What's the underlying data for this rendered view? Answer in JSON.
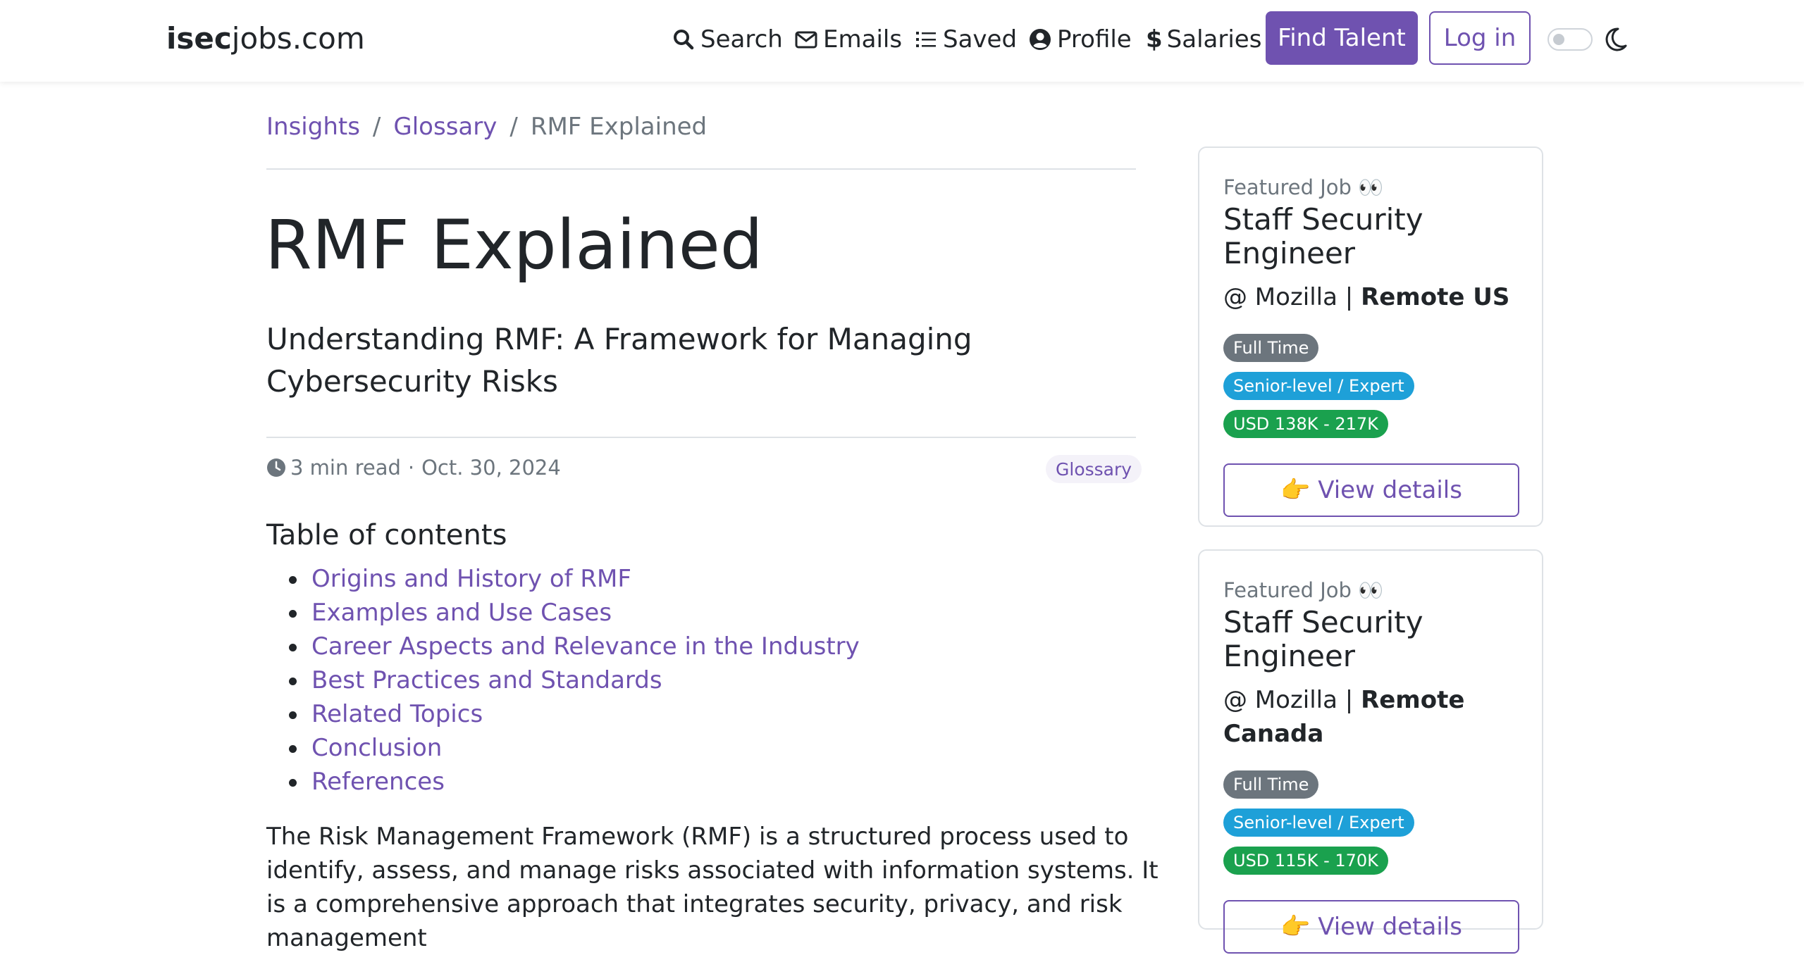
{
  "nav": {
    "brand_bold": "isec",
    "brand_rest": "jobs.com",
    "links": {
      "search": "Search",
      "emails": "Emails",
      "saved": "Saved",
      "profile": "Profile",
      "salaries": "Salaries"
    },
    "find_talent": "Find Talent",
    "login": "Log in",
    "icons": [
      "search-icon",
      "envelope-icon",
      "list-icon",
      "user-circle-icon",
      "dollar-icon",
      "moon-icon"
    ]
  },
  "breadcrumb": {
    "items": [
      "Insights",
      "Glossary"
    ],
    "separator": "/",
    "current": "RMF Explained"
  },
  "article": {
    "title": "RMF Explained",
    "subtitle": "Understanding RMF: A Framework for Managing Cybersecurity Risks",
    "read_time": "3 min read",
    "dot": "·",
    "date": "Oct. 30, 2024",
    "tag": "Glossary",
    "toc_title": "Table of contents",
    "toc": [
      "Origins and History of RMF",
      "Examples and Use Cases",
      "Career Aspects and Relevance in the Industry",
      "Best Practices and Standards",
      "Related Topics",
      "Conclusion",
      "References"
    ],
    "intro": "The Risk Management Framework (RMF) is a structured process used to identify, assess, and manage risks associated with information systems. It is a comprehensive approach that integrates security, privacy, and risk management"
  },
  "sidebar": {
    "cards": [
      {
        "featured": "Featured Job 👀",
        "title": "Staff Security Engineer",
        "company": "@ Mozilla",
        "pipe": "|",
        "location": "Remote US",
        "type": "Full Time",
        "level": "Senior-level / Expert",
        "salary": "USD 138K - 217K",
        "button": "👉 View details"
      },
      {
        "featured": "Featured Job 👀",
        "title": "Staff Security Engineer",
        "company": "@ Mozilla",
        "pipe": "|",
        "location": "Remote Canada",
        "type": "Full Time",
        "level": "Senior-level / Expert",
        "salary": "USD 115K - 170K",
        "button": "👉 View details"
      }
    ]
  },
  "colors": {
    "accent": "#6f52b0",
    "info_badge": "#1ea0d8",
    "success_badge": "#1aa14e",
    "secondary_badge": "#6c757d"
  }
}
